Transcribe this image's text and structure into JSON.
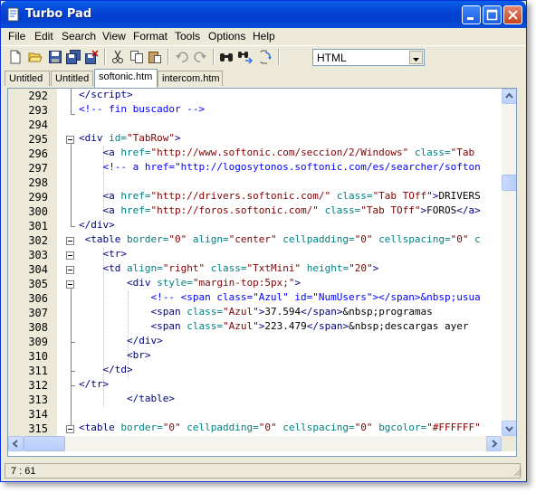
{
  "window": {
    "title": "Turbo Pad"
  },
  "menu": [
    "File",
    "Edit",
    "Search",
    "View",
    "Format",
    "Tools",
    "Options",
    "Help"
  ],
  "toolbar": {
    "icons": [
      "new-file-icon",
      "open-folder-icon",
      "save-icon",
      "save-all-icon",
      "close-file-icon",
      "cut-icon",
      "copy-icon",
      "paste-icon",
      "undo-icon",
      "redo-icon",
      "find-icon",
      "find-next-icon",
      "replace-icon"
    ],
    "syntax": "HTML"
  },
  "tabs": [
    "Untitled",
    "Untitled",
    "softonic.htm",
    "intercom.htm"
  ],
  "active_tab_index": 2,
  "editor": {
    "line_numbers": [
      "292",
      "293",
      "294",
      "295",
      "296",
      "297",
      "298",
      "299",
      "300",
      "301",
      "302",
      "303",
      "304",
      "305",
      "306",
      "307",
      "308",
      "309",
      "310",
      "311",
      "312",
      "313",
      "314",
      "315"
    ]
  },
  "status": {
    "position": "7 : 61"
  },
  "colors": {
    "tag": "#000080",
    "attribute": "#008080",
    "value": "#800000",
    "comment": "#0000ff"
  }
}
